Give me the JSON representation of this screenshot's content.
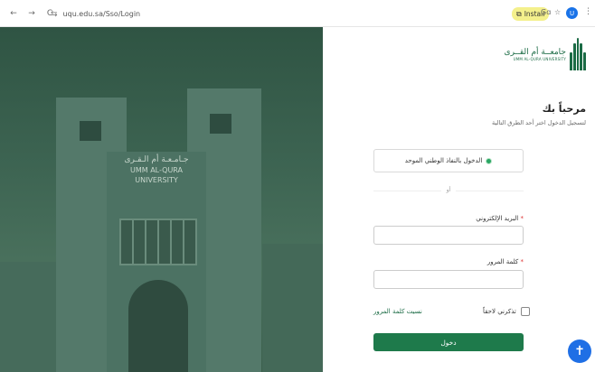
{
  "browser": {
    "back_icon": "←",
    "forward_icon": "→",
    "reload_icon": "C",
    "site_icon": "⇆",
    "url": "uqu.edu.sa/Sso/Login",
    "install_label": "Install",
    "install_icon": "⧉",
    "translate_icon": "Gɑ",
    "star_icon": "☆",
    "profile_initial": "U",
    "menu_icon": "⋮"
  },
  "hero": {
    "sign_arabic": "جـامـعـة أم الـقـرى",
    "sign_line1": "UMM AL-QURA",
    "sign_line2": "UNIVERSITY"
  },
  "logo": {
    "arabic": "جامعــة أم القــرى",
    "english": "UMM AL-QURA UNIVERSITY"
  },
  "login": {
    "welcome": "مرحباً بك",
    "subtitle": "لتسجيل الدخول اختر أحد الطرق التالية",
    "nafath_label": "الدخول بالنفاذ الوطني الموحد",
    "or_label": "أو",
    "email_label": "البريد الإلكتروني",
    "email_value": "",
    "password_label": "كلمة المرور",
    "password_value": "",
    "required_mark": "*",
    "remember_label": "تذكرني لاحقاً",
    "forgot_label": "نسيت كلمة المرور",
    "submit_label": "دخول"
  },
  "accessibility_icon": "✝",
  "colors": {
    "brand_green": "#1e7a4b",
    "accent_blue": "#1f6fe5",
    "install_yellow": "#f4f08c"
  }
}
